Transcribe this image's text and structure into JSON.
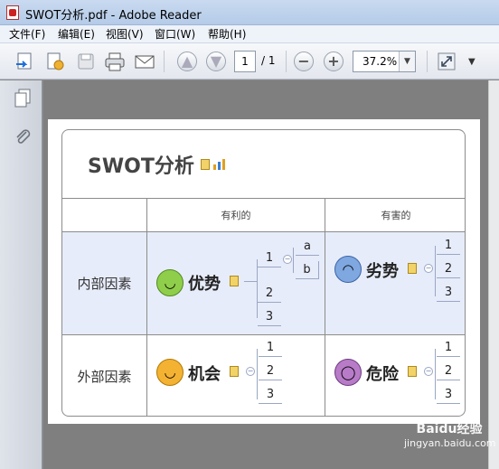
{
  "window": {
    "title": "SWOT分析.pdf - Adobe Reader"
  },
  "menu": [
    "文件(F)",
    "编辑(E)",
    "视图(V)",
    "窗口(W)",
    "帮助(H)"
  ],
  "toolbar": {
    "page_current": "1",
    "page_total": "/ 1",
    "zoom": "37.2%"
  },
  "document": {
    "title": "SWOT分析",
    "col_headers": [
      "有利的",
      "有害的"
    ],
    "row_headers": [
      "内部因素",
      "外部因素"
    ],
    "quadrants": [
      {
        "label": "优势",
        "branches": [
          "1",
          "2",
          "3"
        ],
        "sub_branches": [
          "a",
          "b"
        ]
      },
      {
        "label": "劣势",
        "branches": [
          "1",
          "2",
          "3"
        ]
      },
      {
        "label": "机会",
        "branches": [
          "1",
          "2",
          "3"
        ]
      },
      {
        "label": "危险",
        "branches": [
          "1",
          "2",
          "3"
        ]
      }
    ]
  },
  "watermark": {
    "brand": "Baidu经验",
    "url": "jingyan.baidu.com"
  }
}
